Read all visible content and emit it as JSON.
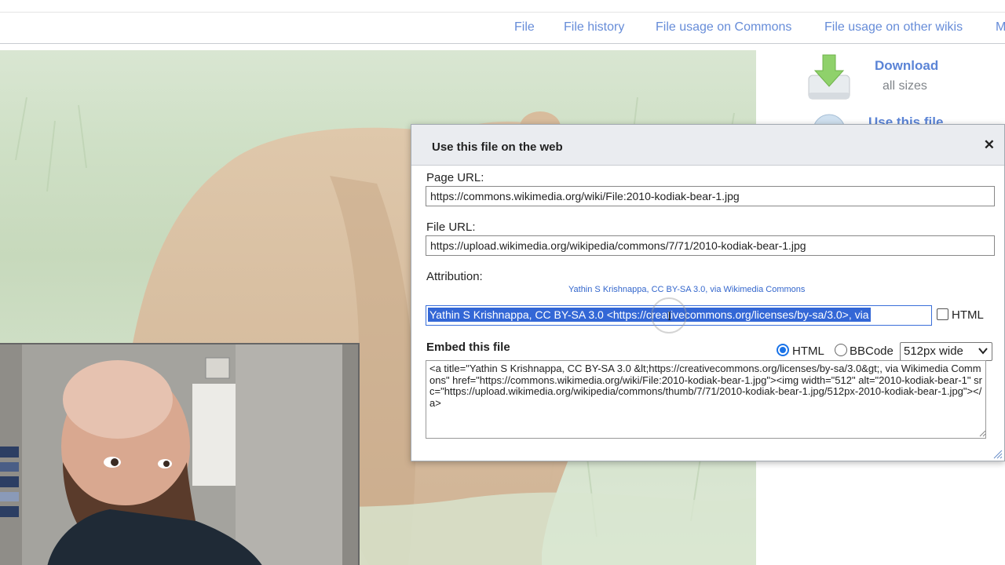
{
  "file_tabs": [
    "File",
    "File history",
    "File usage on Commons",
    "File usage on other wikis",
    "M"
  ],
  "download": {
    "title": "Download",
    "subtitle": "all sizes",
    "use_title": "Use this file"
  },
  "dialog": {
    "title": "Use this file on the web",
    "close_icon": "close-icon",
    "page_url_label": "Page URL:",
    "page_url": "https://commons.wikimedia.org/wiki/File:2010-kodiak-bear-1.jpg",
    "file_url_label": "File URL:",
    "file_url": "https://upload.wikimedia.org/wikipedia/commons/7/71/2010-kodiak-bear-1.jpg",
    "attribution_label": "Attribution:",
    "attribution_preview": "Yathin S Krishnappa, CC BY-SA 3.0, via Wikimedia Commons",
    "attribution_text": "Yathin S Krishnappa, CC BY-SA 3.0 <https://creativecommons.org/licenses/by-sa/3.0>, via",
    "attribution_html_label": "HTML",
    "attribution_html_checked": false,
    "embed_label": "Embed this file",
    "embed_format_html": "HTML",
    "embed_format_bbcode": "BBCode",
    "embed_format_selected": "HTML",
    "embed_size": "512px wide",
    "embed_code": "<a title=\"Yathin S Krishnappa, CC BY-SA 3.0 &lt;https://creativecommons.org/licenses/by-sa/3.0&gt;, via Wikimedia Commons\" href=\"https://commons.wikimedia.org/wiki/File:2010-kodiak-bear-1.jpg\"><img width=\"512\" alt=\"2010-kodiak-bear-1\" src=\"https://upload.wikimedia.org/wikipedia/commons/thumb/7/71/2010-kodiak-bear-1.jpg/512px-2010-kodiak-bear-1.jpg\"></a>"
  },
  "colors": {
    "link": "#3366cc",
    "selection": "#3367d6",
    "radio_active": "#1a73e8"
  }
}
